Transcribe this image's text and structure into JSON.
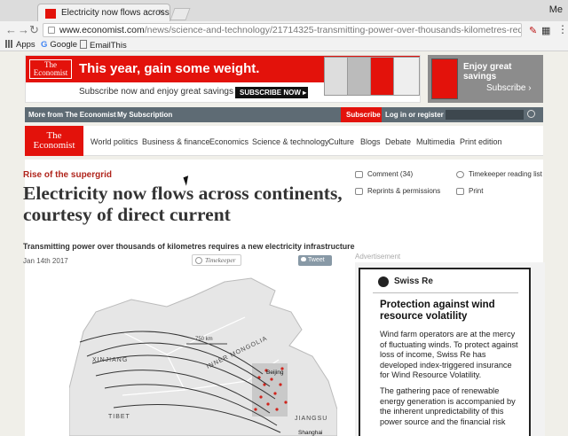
{
  "browser": {
    "tab_title": "Electricity now flows across co",
    "tab_close": "×",
    "profile": "Me",
    "url_host": "www.economist.com",
    "url_path": "/news/science-and-technology/21714325-transmitting-power-over-thousands-kilometres-requires-new-ele...",
    "bookmarks": [
      "Apps",
      "Google",
      "EmailThis"
    ]
  },
  "leaderboard": {
    "logo": "The Economist",
    "headline": "This year, gain some weight.",
    "tagline": "Subscribe now and enjoy great savings",
    "button": "SUBSCRIBE NOW ▸",
    "right_text": "Enjoy great savings",
    "right_cta": "Subscribe ›"
  },
  "topbar": {
    "more_from": "More from The Economist",
    "my_subscription": "My Subscription",
    "subscribe": "Subscribe",
    "login": "Log in or register"
  },
  "nav": {
    "logo": "The Economist",
    "items": [
      "World politics",
      "Business & finance",
      "Economics",
      "Science & technology",
      "Culture",
      "Blogs",
      "Debate",
      "Multimedia",
      "Print edition"
    ]
  },
  "article": {
    "flytitle": "Rise of the supergrid",
    "headline": "Electricity now flows across continents, courtesy of direct current",
    "rubric": "Transmitting power over thousands of kilometres requires a new electricity infrastructure",
    "date": "Jan 14th 2017",
    "timekeeper": "Timekeeper",
    "tweet": "Tweet"
  },
  "tools": {
    "comment": "Comment (34)",
    "timekeeper_list": "Timekeeper reading list",
    "reprints": "Reprints & permissions",
    "print": "Print"
  },
  "map": {
    "scale": "750 km",
    "labels": [
      "XINJIANG",
      "INNER MONGOLIA",
      "Beijing",
      "TIBET",
      "JIANGSU",
      "Shanghai"
    ]
  },
  "advert": {
    "label": "Advertisement",
    "brand": "Swiss Re",
    "title": "Protection against wind resource volatility",
    "p1": "Wind farm operators are at the mercy of fluctuating winds. To protect against loss of income, Swiss Re has developed index-triggered insurance for Wind Resource Volatility.",
    "p2": "The gathering pace of renewable energy generation is accompanied by the inherent unpredictability of this power source and the financial risk"
  }
}
